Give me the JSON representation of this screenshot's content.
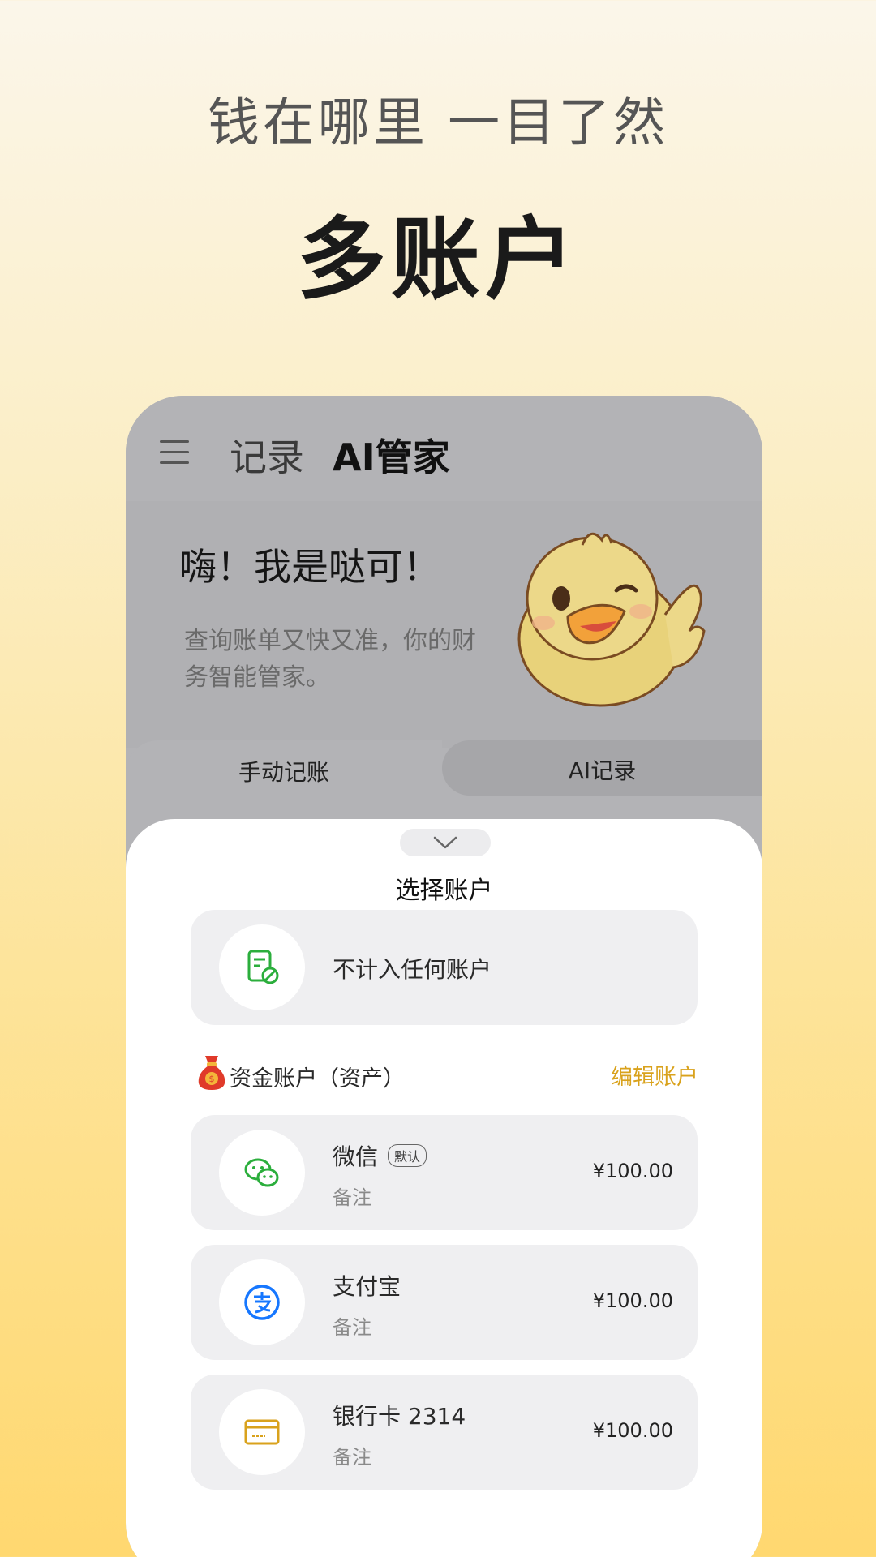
{
  "promo": {
    "subtitle": "钱在哪里 一目了然",
    "headline": "多账户"
  },
  "app": {
    "tabs": {
      "record": "记录",
      "ai": "AI管家"
    },
    "hero": {
      "greeting": "嗨！我是哒可！",
      "description": "查询账单又快又准，你的财务智能管家。"
    },
    "modes": {
      "manual": "手动记账",
      "ai": "AI记录"
    },
    "sheet": {
      "title": "选择账户",
      "none_option": "不计入任何账户",
      "section_label": "资金账户（资产）",
      "edit_label": "编辑账户",
      "accounts": [
        {
          "name": "微信",
          "badge": "默认",
          "note": "备注",
          "amount": "¥100.00",
          "icon": "wechat-icon"
        },
        {
          "name": "支付宝",
          "note": "备注",
          "amount": "¥100.00",
          "icon": "alipay-icon"
        },
        {
          "name": "银行卡 2314",
          "note": "备注",
          "amount": "¥100.00",
          "icon": "bank-card-icon"
        }
      ]
    }
  },
  "colors": {
    "accent": "#d9a21c",
    "wechat": "#2bae3c",
    "alipay": "#1677ff"
  }
}
